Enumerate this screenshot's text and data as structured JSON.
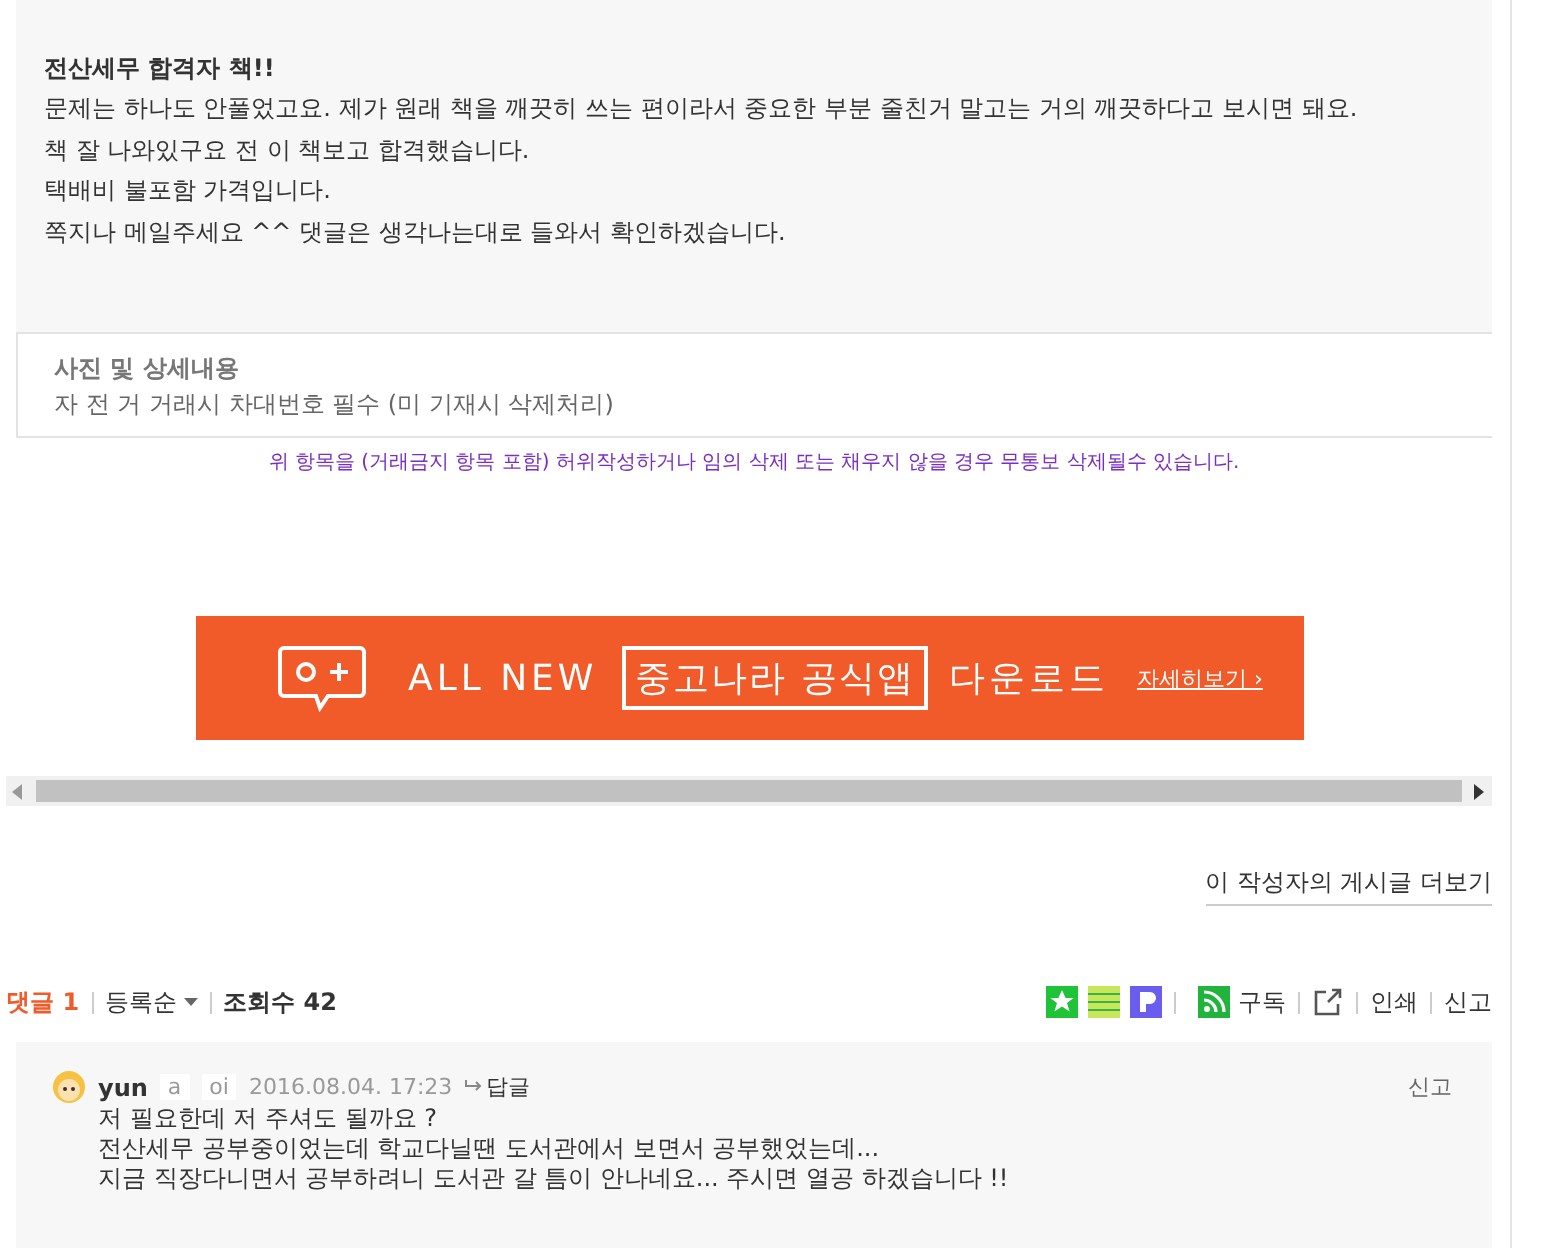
{
  "post": {
    "lines": [
      "전산세무 합격자 책!!",
      "문제는 하나도 안풀었고요. 제가 원래 책을 깨끗히 쓰는 편이라서 중요한 부분 줄친거 말고는 거의 깨끗하다고 보시면 돼요.",
      "책 잘 나와있구요 전 이 책보고 합격했습니다.",
      "택배비 불포함 가격입니다.",
      "쪽지나 메일주세요 ^^ 댓글은 생각나는대로 들와서 확인하겠습니다."
    ]
  },
  "details": {
    "title": "사진  및 상세내용",
    "text": "자 전 거 거래시 차대번호 필수 (미 기재시 삭제처리)"
  },
  "notice": "위 항목을 (거래금지 항목 포함) 허위작성하거나 임의 삭제 또는 채우지 않을 경우 무통보 삭제될수 있습니다.",
  "banner": {
    "lead": "ALL NEW",
    "boxed": "중고나라 공식앱",
    "tail": "다운로드",
    "link": "자세히보기 ›"
  },
  "more_posts": "이 작성자의 게시글 더보기",
  "comment_bar": {
    "comments_label": "댓글",
    "comments_count": "1",
    "sort": "등록순",
    "views": "조회수 42",
    "subscribe": "구독",
    "print": "인쇄",
    "report": "신고"
  },
  "comments": [
    {
      "author": "yun",
      "author_rest": [
        "a",
        "oi"
      ],
      "date": "2016.08.04. 17:23",
      "reply": "답글",
      "report": "신고",
      "lines": [
        "저 필요한데 저 주셔도 될까요 ?",
        "전산세무 공부중이었는데 학교다닐땐 도서관에서 보면서 공부했었는데...",
        "지금 직장다니면서 공부하려니 도서관 갈 틈이 안나네요... 주시면 열공 하겠습니다 !!"
      ]
    }
  ]
}
